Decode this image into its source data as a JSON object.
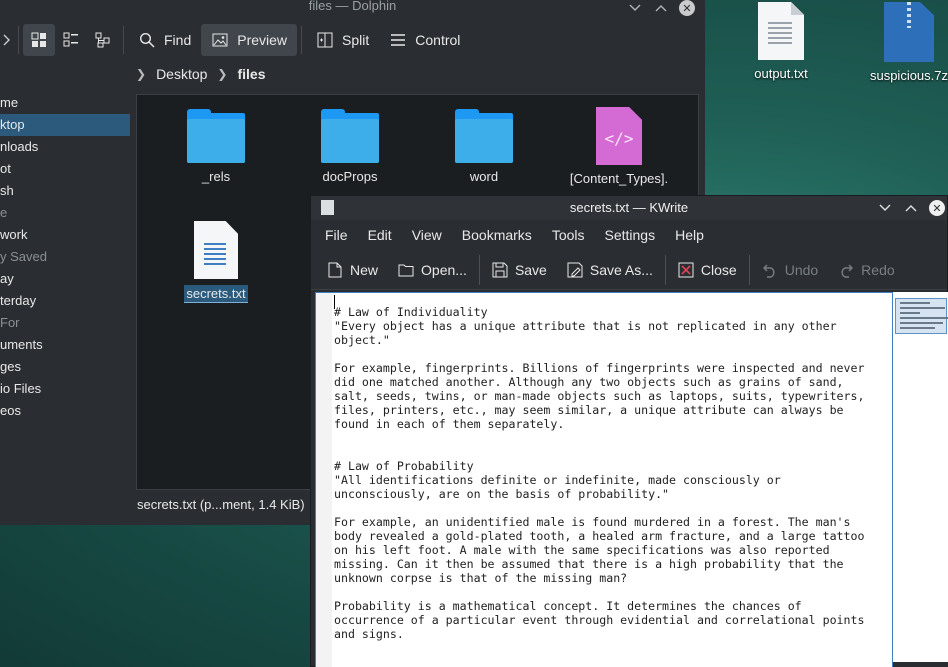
{
  "desktop": {
    "icons": [
      {
        "label": "output.txt",
        "icon": "text-file-icon"
      },
      {
        "label": "suspicious.7z",
        "icon": "archive-icon"
      }
    ]
  },
  "dolphin": {
    "title": "files — Dolphin",
    "toolbar": {
      "find": "Find",
      "preview": "Preview",
      "split": "Split",
      "control": "Control"
    },
    "breadcrumb": [
      "Desktop",
      "files"
    ],
    "places": [
      {
        "label": "me",
        "type": "item"
      },
      {
        "label": "ktop",
        "type": "item",
        "selected": true
      },
      {
        "label": "nloads",
        "type": "item"
      },
      {
        "label": "ot",
        "type": "item"
      },
      {
        "label": "sh",
        "type": "item"
      },
      {
        "label": "e",
        "type": "header"
      },
      {
        "label": "work",
        "type": "item"
      },
      {
        "label": "y Saved",
        "type": "header"
      },
      {
        "label": "ay",
        "type": "item"
      },
      {
        "label": "terday",
        "type": "item"
      },
      {
        "label": "For",
        "type": "header"
      },
      {
        "label": "uments",
        "type": "item"
      },
      {
        "label": "ges",
        "type": "item"
      },
      {
        "label": "io Files",
        "type": "item"
      },
      {
        "label": "eos",
        "type": "item"
      }
    ],
    "files": [
      {
        "name": "_rels",
        "kind": "folder"
      },
      {
        "name": "docProps",
        "kind": "folder"
      },
      {
        "name": "word",
        "kind": "folder"
      },
      {
        "name": "[Content_Types].",
        "kind": "code"
      },
      {
        "name": "secrets.txt",
        "kind": "text",
        "selected": true
      }
    ],
    "status": "secrets.txt (p...ment, 1.4 KiB)"
  },
  "kwrite": {
    "title": "secrets.txt — KWrite",
    "menu": [
      "File",
      "Edit",
      "View",
      "Bookmarks",
      "Tools",
      "Settings",
      "Help"
    ],
    "toolbar": {
      "new": "New",
      "open": "Open...",
      "save": "Save",
      "save_as": "Save As...",
      "close": "Close",
      "undo": "Undo",
      "redo": "Redo"
    },
    "content": "# Law of Individuality\n\"Every object has a unique attribute that is not replicated in any other\nobject.\"\n\nFor example, fingerprints. Billions of fingerprints were inspected and never\ndid one matched another. Although any two objects such as grains of sand,\nsalt, seeds, twins, or man-made objects such as laptops, suits, typewriters,\nfiles, printers, etc., may seem similar, a unique attribute can always be\nfound in each of them separately.\n\n\n# Law of Probability\n\"All identifications definite or indefinite, made consciously or\nunconsciously, are on the basis of probability.\"\n\nFor example, an unidentified male is found murdered in a forest. The man's\nbody revealed a gold-plated tooth, a healed arm fracture, and a large tattoo\non his left foot. A male with the same specifications was also reported\nmissing. Can it then be assumed that there is a high probability that the\nunknown corpse is that of the missing man?\n\nProbability is a mathematical concept. It determines the chances of\noccurrence of a particular event through evidential and correlational points\nand signs."
  }
}
